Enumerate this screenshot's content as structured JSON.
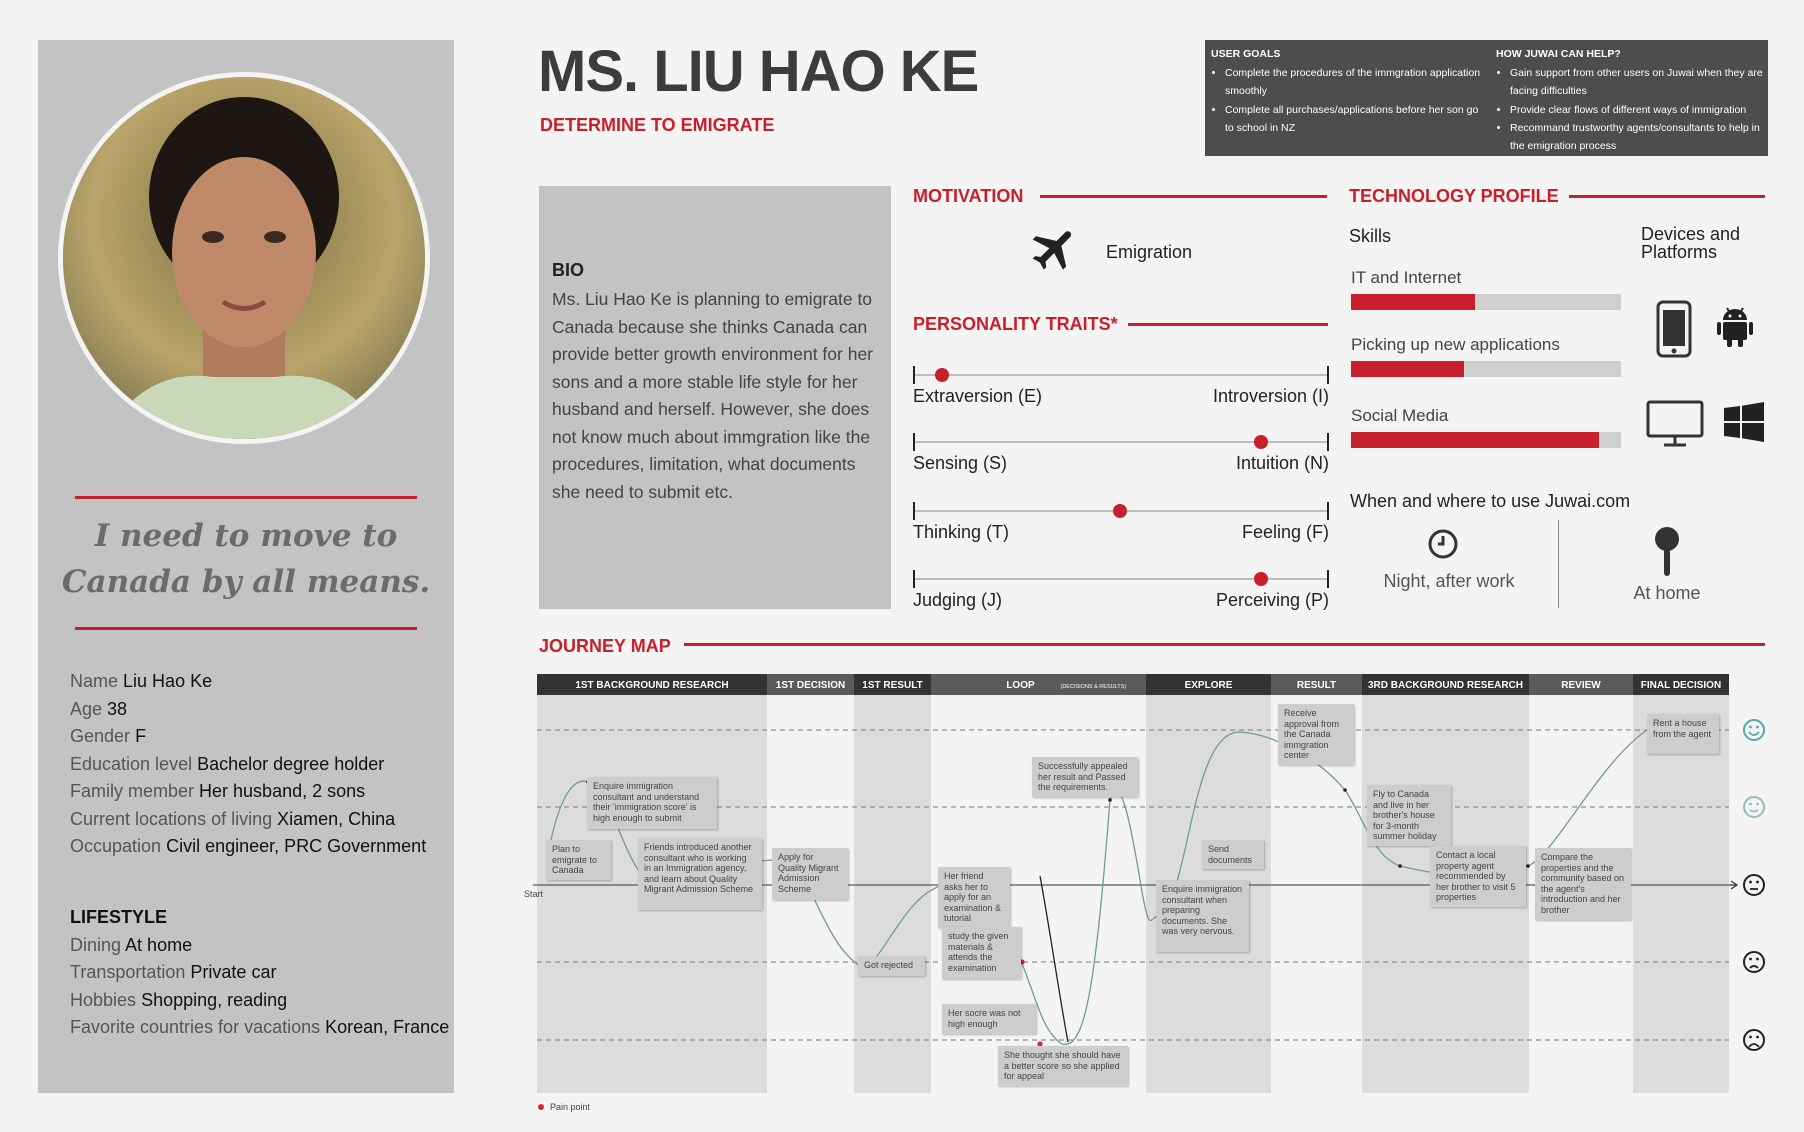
{
  "persona": {
    "name": "MS. LIU HAO KE",
    "tagline": "DETERMINE TO EMIGRATE",
    "quote": "I need to move to Canada by all means."
  },
  "user_goals": {
    "title": "USER GOALS",
    "items": [
      "Complete the procedures of the immgration application smoothly",
      "Complete all purchases/applications before her son go to school in NZ"
    ]
  },
  "juwai_help": {
    "title": "HOW JUWAI CAN HELP?",
    "items": [
      "Gain support from other users on Juwai when they are facing difficulties",
      "Provide clear flows of different ways of immigration",
      "Recommand trustworthy agents/consultants to help in the emigration process"
    ]
  },
  "details": [
    {
      "label": "Name",
      "value": "Liu Hao Ke"
    },
    {
      "label": "Age",
      "value": "38"
    },
    {
      "label": "Gender",
      "value": "F"
    },
    {
      "label": "Education level",
      "value": "Bachelor degree holder"
    },
    {
      "label": "Family member",
      "value": "Her husband, 2 sons"
    },
    {
      "label": "Current locations of living",
      "value": "Xiamen, China"
    },
    {
      "label": "Occupation",
      "value": "Civil engineer, PRC Government"
    }
  ],
  "lifestyle": {
    "title": "LIFESTYLE",
    "items": [
      {
        "label": "Dining",
        "value": "At home"
      },
      {
        "label": "Transportation",
        "value": "Private car"
      },
      {
        "label": "Hobbies",
        "value": "Shopping, reading"
      },
      {
        "label": "Favorite countries for vacations",
        "value": "Korean, France"
      }
    ]
  },
  "bio": {
    "title": "BIO",
    "text": "Ms. Liu Hao Ke is planning to emigrate to Canada because she thinks Canada can provide better growth environment for her sons and a more stable life style for her husband and herself. However, she does not know much about immgration like the procedures, limitation, what documents she need to submit etc."
  },
  "motivation": {
    "title": "MOTIVATION",
    "icon": "airplane-icon",
    "label": "Emigration"
  },
  "personality": {
    "title": "PERSONALITY TRAITS*",
    "traits": [
      {
        "left": "Extraversion (E)",
        "right": "Introversion (I)",
        "value": 0.07
      },
      {
        "left": "Sensing (S)",
        "right": "Intuition (N)",
        "value": 0.84
      },
      {
        "left": "Thinking (T)",
        "right": "Feeling (F)",
        "value": 0.5
      },
      {
        "left": "Judging (J)",
        "right": "Perceiving (P)",
        "value": 0.84
      }
    ]
  },
  "technology": {
    "title": "TECHNOLOGY PROFILE",
    "skills_title": "Skills",
    "devices_title": "Devices and Platforms",
    "skills": [
      {
        "label": "IT and Internet",
        "level": 0.46
      },
      {
        "label": "Picking up new applications",
        "level": 0.42
      },
      {
        "label": "Social Media",
        "level": 0.92
      }
    ],
    "devices": [
      "smartphone-icon",
      "android-icon",
      "monitor-icon",
      "windows-icon"
    ],
    "usage_title": "When and where to use Juwai.com",
    "usage": [
      {
        "icon": "clock-icon",
        "label": "Night, after work"
      },
      {
        "icon": "location-pin-icon",
        "label": "At home"
      }
    ]
  },
  "journey": {
    "title": "JOURNEY MAP",
    "start_label": "Start",
    "legend": "Pain point",
    "phases": [
      {
        "label": "1ST BACKGROUND RESEARCH",
        "shaded": true
      },
      {
        "label": "1ST DECISION",
        "shaded": false
      },
      {
        "label": "1ST RESULT",
        "shaded": true
      },
      {
        "label": "LOOP",
        "sub": "(DECISIONS & RESULTS)",
        "shaded": false
      },
      {
        "label": "EXPLORE",
        "shaded": true
      },
      {
        "label": "RESULT",
        "shaded": false
      },
      {
        "label": "3RD BACKGROUND RESEARCH",
        "shaded": true
      },
      {
        "label": "REVIEW",
        "shaded": false
      },
      {
        "label": "FINAL DECISION",
        "shaded": true
      }
    ],
    "emotions": [
      "very-happy-face-icon",
      "happy-face-icon",
      "neutral-face-icon",
      "sad-face-icon",
      "very-sad-face-icon"
    ],
    "notes": [
      "Plan to emigrate to Canada",
      "Enquire immigration consultant and understand their 'immigration score' is high enough to submit",
      "Friends introduced another consultant who is working in an Immigration agency, and learn about Quality Migrant Admission Scheme",
      "Apply for Quality Migrant Admission Scheme",
      "Got rejected",
      "Her friend asks her to apply for an examination & tutorial",
      "study the given materials & attends the examination",
      "Her socre was not high enough",
      "She thought she should have a better score so she applied for appeal",
      "Successfully appealed her result and Passed the requirements.",
      "Enquire immigration consultant when preparing documents. She was very nervous.",
      "Send documents",
      "Receive approval from the Canada immgration center",
      "Fly to Canada and live in her brother's house for 3-month summer holiday",
      "Contact a local property agent recommended by her brother to visit 5 properties",
      "Compare the properties and the community based on the agent's introduction and her brother",
      "Rent a house from the agent"
    ],
    "colors": {
      "header": "#333333",
      "phase_shade": "#dcdcdc",
      "curve": "#6f9c9a",
      "pain": "#e0202a",
      "accent": "#c8202a"
    }
  }
}
